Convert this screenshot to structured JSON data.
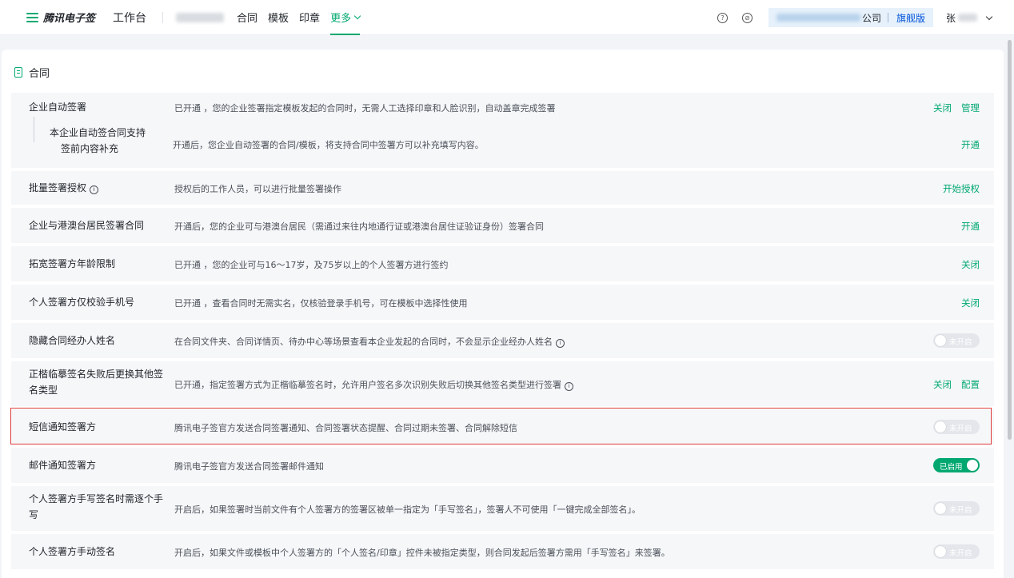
{
  "nav": {
    "brand": "腾讯电子签",
    "workbench": "工作台",
    "links": [
      "合同",
      "模板",
      "印章"
    ],
    "more": "更多",
    "help_icon": "question-circle-icon",
    "link_icon": "link-circle-icon",
    "company_suffix": "公司",
    "edition": "旗舰版",
    "user_initial": "张"
  },
  "section": {
    "title": "合同",
    "icon": "contract-doc-icon"
  },
  "rows": [
    {
      "name": "企业自动签署",
      "desc": "已开通 ，您的企业签署指定模板发起的合同时，无需人工选择印章和人脸识别，自动盖章完成签署",
      "actions": [
        "关闭",
        "管理"
      ],
      "sub": {
        "name_line1": "本企业自动签合同支持",
        "name_line2": "签前内容补充",
        "desc": "开通后，您企业自动签署的合同/模板，将支持合同中签署方可以补充填写内容。",
        "action": "开通"
      }
    },
    {
      "name": "批量签署授权",
      "desc": "授权后的工作人员，可以进行批量签署操作",
      "actions": [
        "开始授权"
      ]
    },
    {
      "name": "企业与港澳台居民签署合同",
      "desc": "开通后，您的企业可与港澳台居民（需通过来往内地通行证或港澳台居住证验证身份）签署合同",
      "actions": [
        "开通"
      ]
    },
    {
      "name": "拓宽签署方年龄限制",
      "desc": "已开通 ，您的企业可与16～17岁，及75岁以上的个人签署方进行签约",
      "actions": [
        "关闭"
      ]
    },
    {
      "name": "个人签署方仅校验手机号",
      "desc": "已开通 ，查看合同时无需实名，仅核验登录手机号，可在模板中选择性使用",
      "actions": [
        "关闭"
      ]
    },
    {
      "name": "隐藏合同经办人姓名",
      "desc": "在合同文件夹、合同详情页、待办中心等场景查看本企业发起的合同时，不会显示企业经办人姓名",
      "toggle": "未开启"
    },
    {
      "name_line1": "正楷临摹签名失败后更换其他签",
      "name_line2": "名类型",
      "desc": "已开通，指定签署方式为正楷临摹签名时，允许用户签名多次识别失败后切换其他签名类型进行签署",
      "actions": [
        "关闭",
        "配置"
      ]
    },
    {
      "name": "短信通知签署方",
      "desc": "腾讯电子签官方发送合同签署通知、合同签署状态提醒、合同过期未签署、合同解除短信",
      "toggle": "未开启"
    },
    {
      "name": "邮件通知签署方",
      "desc": "腾讯电子签官方发送合同签署邮件通知",
      "toggle": "已启用"
    },
    {
      "name_line1": "个人签署方手写签名时需逐个手",
      "name_line2": "写",
      "desc": "开启后，如果签署时当前文件有个人签署方的签署区被单一指定为「手写签名」，签署人不可使用「一键完成全部签名」。",
      "toggle": "未开启"
    },
    {
      "name": "个人签署方手动签名",
      "desc": "开启后，如果文件或模板中个人签署方的「个人签名/印章」控件未被指定类型，则合同发起后签署方需用「手写签名」来签署。",
      "toggle": "未开启"
    }
  ],
  "colors": {
    "accent": "#00a870",
    "edition": "#0052d9",
    "highlight": "#e03c3c",
    "row_bg": "#f6f7f9"
  }
}
